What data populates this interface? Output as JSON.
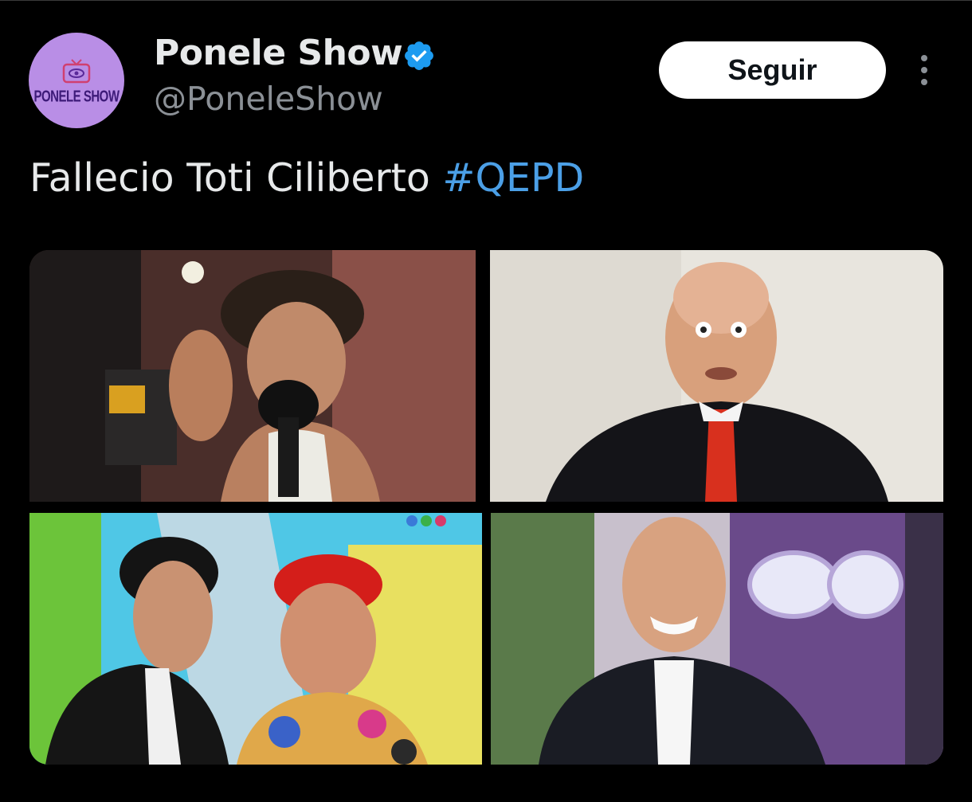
{
  "author": {
    "avatar_label": "PONELE SHOW",
    "display_name": "Ponele Show",
    "handle": "@PoneleShow",
    "verified_icon": "verified-badge-icon"
  },
  "actions": {
    "follow_label": "Seguir",
    "more_icon": "more-vertical-icon"
  },
  "tweet": {
    "text": "Fallecio Toti Ciliberto ",
    "hashtag": "#QEPD"
  },
  "media": {
    "photos": [
      {
        "name": "photo-1"
      },
      {
        "name": "photo-2"
      },
      {
        "name": "photo-3"
      },
      {
        "name": "photo-4"
      }
    ]
  },
  "colors": {
    "background": "#000000",
    "text_primary": "#e7e9ea",
    "text_secondary": "#8b9096",
    "hashtag": "#4b9fe6",
    "verified": "#1d9bf0",
    "avatar_bg": "#b98ee6",
    "follow_bg": "#ffffff"
  }
}
